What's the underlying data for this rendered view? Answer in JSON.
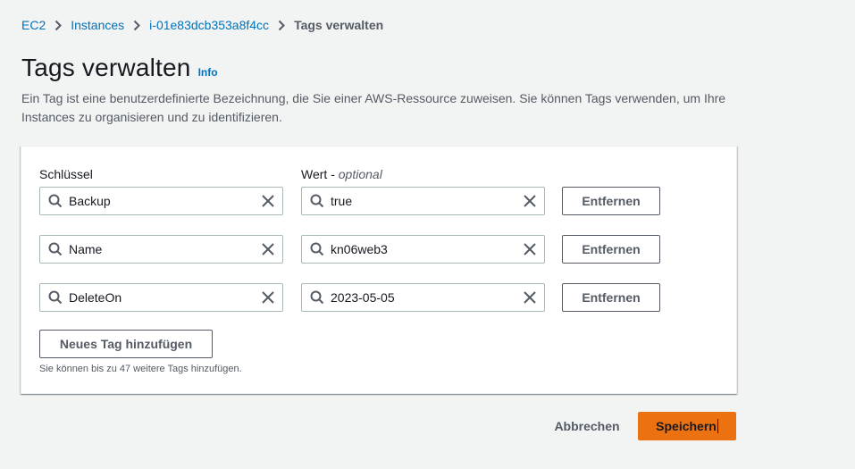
{
  "breadcrumb": {
    "items": [
      "EC2",
      "Instances",
      "i-01e83dcb353a8f4cc"
    ],
    "current": "Tags verwalten"
  },
  "header": {
    "title": "Tags verwalten",
    "info": "Info",
    "description": "Ein Tag ist eine benutzerdefinierte Bezeichnung, die Sie einer AWS-Ressource zuweisen. Sie können Tags verwenden, um Ihre Instances zu organisieren und zu identifizieren."
  },
  "tags": {
    "key_label": "Schlüssel",
    "value_label": "Wert",
    "value_optional": "optional",
    "rows": [
      {
        "key": "Backup",
        "value": "true",
        "remove": "Entfernen"
      },
      {
        "key": "Name",
        "value": "kn06web3",
        "remove": "Entfernen"
      },
      {
        "key": "DeleteOn",
        "value": "2023-05-05",
        "remove": "Entfernen"
      }
    ],
    "add_button": "Neues Tag hinzufügen",
    "hint": "Sie können bis zu 47 weitere Tags hinzufügen."
  },
  "actions": {
    "cancel": "Abbrechen",
    "save": "Speichern"
  },
  "icons": {
    "breadcrumb_separator": "chevron-right-icon",
    "field_prefix": "search-icon",
    "field_clear": "close-icon"
  },
  "colors": {
    "link": "#0073bb",
    "primary": "#ec7211",
    "text_secondary": "#545b64",
    "background": "#f2f3f3"
  }
}
